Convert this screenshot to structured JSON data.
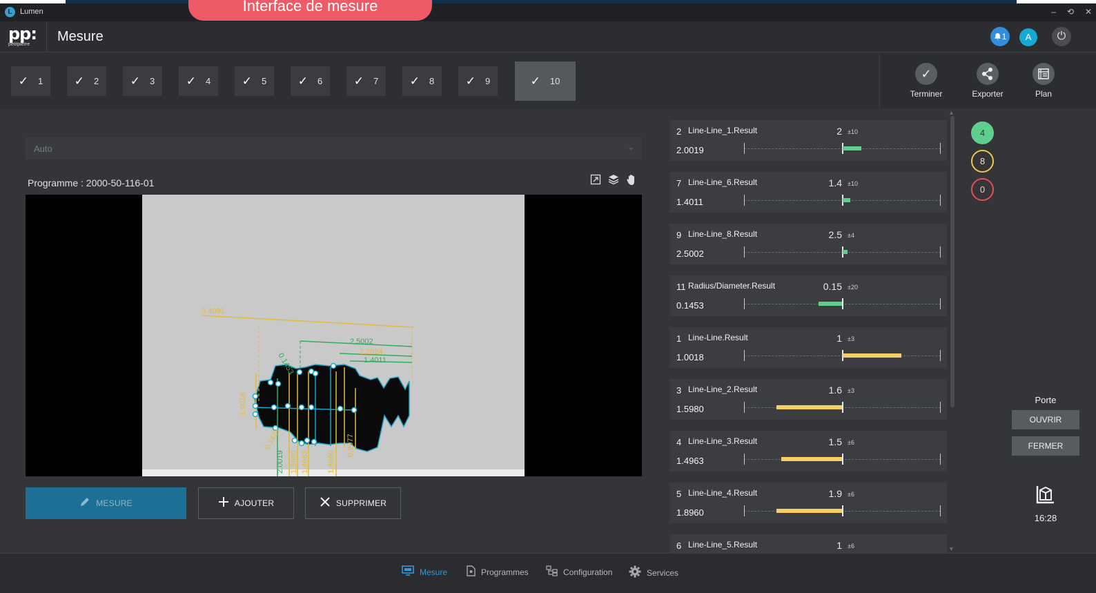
{
  "window": {
    "app_name": "Lumen",
    "app_logo_letter": "L",
    "controls": [
      "–",
      "⟲",
      "✕"
    ]
  },
  "banner": "Interface de mesure",
  "header": {
    "brand": "pp:",
    "brand_sub": "petitpierre",
    "title": "Mesure",
    "notifications_count": "1",
    "avatar_letter": "A",
    "power_icon": "⏻"
  },
  "steps": [
    {
      "label": "1"
    },
    {
      "label": "2"
    },
    {
      "label": "3"
    },
    {
      "label": "4"
    },
    {
      "label": "5"
    },
    {
      "label": "6"
    },
    {
      "label": "7"
    },
    {
      "label": "8"
    },
    {
      "label": "9"
    },
    {
      "label": "10"
    }
  ],
  "step_check": "✓",
  "actions": {
    "finish": "Terminer",
    "export": "Exporter",
    "plan": "Plan"
  },
  "main": {
    "mode_value": "Auto",
    "chevron": "⌄",
    "program_label": "Programme : 2000-50-116-01",
    "buttons": {
      "measure": "MESURE",
      "add": "AJOUTER",
      "delete": "SUPPRIMER"
    }
  },
  "overlay_labels": {
    "dim1": "3.4091",
    "dim2": "2.5002",
    "dim3": "2.2024",
    "dim4": "1.4011",
    "dim5": "1.0018",
    "dim6": "0.1453",
    "dim7": "0.1421",
    "dim8": "1.5980",
    "dim9": "1.4963",
    "dim10": "1.8960",
    "dim11": "2.0019",
    "dim12": "0.9977"
  },
  "results": [
    {
      "idx": "2",
      "name": "Line-Line_1.Result",
      "nominal": "2",
      "tol": "±10",
      "measured": "2.0019",
      "status": "ok",
      "deviation": 0.19
    },
    {
      "idx": "7",
      "name": "Line-Line_6.Result",
      "nominal": "1.4",
      "tol": "±10",
      "measured": "1.4011",
      "status": "ok",
      "deviation": 0.08
    },
    {
      "idx": "9",
      "name": "Line-Line_8.Result",
      "nominal": "2.5",
      "tol": "±4",
      "measured": "2.5002",
      "status": "ok",
      "deviation": 0.05
    },
    {
      "idx": "11",
      "name": "Radius/Diameter.Result",
      "nominal": "0.15",
      "tol": "±20",
      "measured": "0.1453",
      "status": "ok",
      "deviation": -0.24
    },
    {
      "idx": "1",
      "name": "Line-Line.Result",
      "nominal": "1",
      "tol": "±3",
      "measured": "1.0018",
      "status": "warn",
      "deviation": 0.6
    },
    {
      "idx": "3",
      "name": "Line-Line_2.Result",
      "nominal": "1.6",
      "tol": "±3",
      "measured": "1.5980",
      "status": "warn",
      "deviation": -0.67
    },
    {
      "idx": "4",
      "name": "Line-Line_3.Result",
      "nominal": "1.5",
      "tol": "±6",
      "measured": "1.4963",
      "status": "warn",
      "deviation": -0.62
    },
    {
      "idx": "5",
      "name": "Line-Line_4.Result",
      "nominal": "1.9",
      "tol": "±6",
      "measured": "1.8960",
      "status": "warn",
      "deviation": -0.67
    },
    {
      "idx": "6",
      "name": "Line-Line_5.Result",
      "nominal": "1",
      "tol": "±6",
      "measured": "",
      "status": "warn",
      "deviation": 0
    }
  ],
  "counters": {
    "ok": "4",
    "warn": "8",
    "error": "0"
  },
  "colors": {
    "ok": "#5fcf8e",
    "warn": "#f5d060",
    "error": "#e74f4f",
    "accent": "#2f9ad6"
  },
  "door": {
    "label": "Porte",
    "open": "OUVRIR",
    "close": "FERMER"
  },
  "clock": "16:28",
  "bottom_nav": {
    "measure": "Mesure",
    "programs": "Programmes",
    "configuration": "Configuration",
    "services": "Services"
  }
}
